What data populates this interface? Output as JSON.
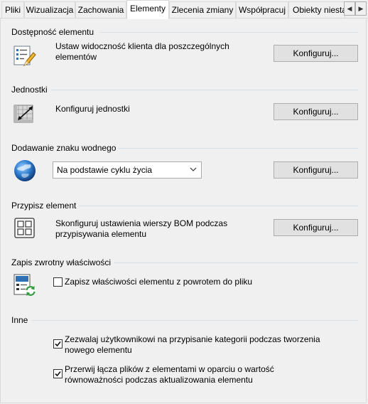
{
  "tabs": [
    {
      "label": "Pliki"
    },
    {
      "label": "Wizualizacja"
    },
    {
      "label": "Zachowania"
    },
    {
      "label": "Elementy",
      "active": true
    },
    {
      "label": "Zlecenia zmiany"
    },
    {
      "label": "Współpracuj"
    },
    {
      "label": "Obiekty niesta"
    }
  ],
  "sections": {
    "visibility": {
      "title": "Dostępność elementu",
      "description": "Ustaw widoczność klienta dla poszczególnych elementów",
      "button": "Konfiguruj...",
      "icon": "checklist-pencil-icon"
    },
    "units": {
      "title": "Jednostki",
      "description": "Konfiguruj jednostki",
      "button": "Konfiguruj...",
      "icon": "units-ruler-icon"
    },
    "watermark": {
      "title": "Dodawanie znaku wodnego",
      "select_value": "Na podstawie cyklu życia",
      "button": "Konfiguruj...",
      "icon": "globe-icon"
    },
    "assign": {
      "title": "Przypisz element",
      "description": "Skonfiguruj ustawienia wierszy BOM podczas przypisywania elementu",
      "button": "Konfiguruj...",
      "icon": "grid-bom-icon"
    },
    "writeback": {
      "title": "Zapis zwrotny właściwości",
      "checkbox_label": "Zapisz właściwości elementu z powrotem do pliku",
      "checked": false,
      "icon": "properties-sync-icon"
    },
    "other": {
      "title": "Inne",
      "options": [
        {
          "label": "Zezwalaj użytkownikowi na przypisanie kategorii podczas tworzenia nowego elementu",
          "checked": true
        },
        {
          "label": "Przerwij łącza plików z elementami w oparciu o wartość równoważności podczas aktualizowania elementu",
          "checked": true
        }
      ]
    }
  }
}
